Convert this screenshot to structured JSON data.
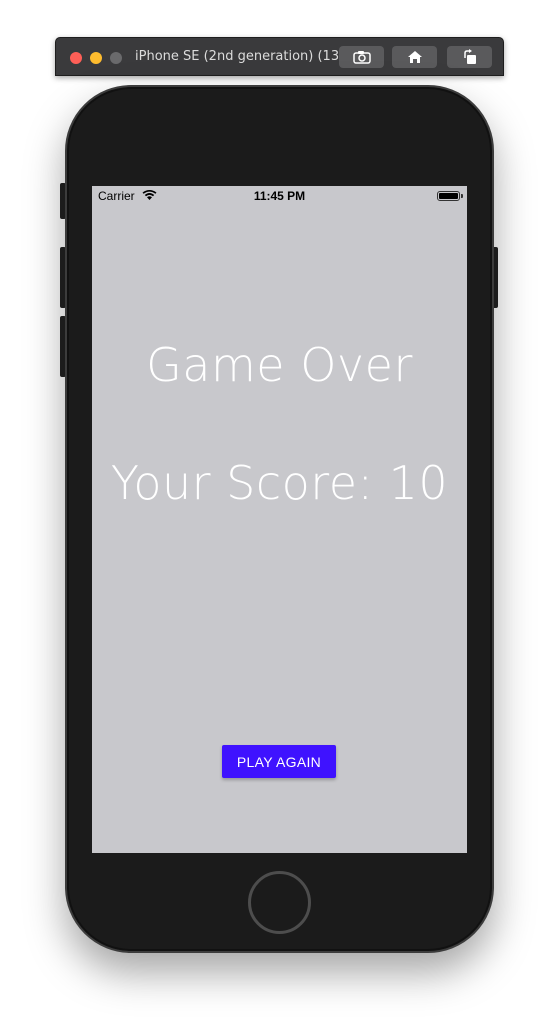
{
  "simulator": {
    "title": "iPhone SE (2nd generation) (13...",
    "buttons": [
      {
        "icon": "screenshot-icon"
      },
      {
        "icon": "home-icon"
      },
      {
        "icon": "rotate-icon"
      }
    ]
  },
  "status_bar": {
    "carrier": "Carrier",
    "time": "11:45 PM"
  },
  "game": {
    "title": "Game Over",
    "score_text": "Your Score: 10",
    "play_again_label": "PLAY AGAIN"
  },
  "colors": {
    "screen_background": "#c8c8cc",
    "button_background": "#3f12ff",
    "text": "#ffffff"
  }
}
